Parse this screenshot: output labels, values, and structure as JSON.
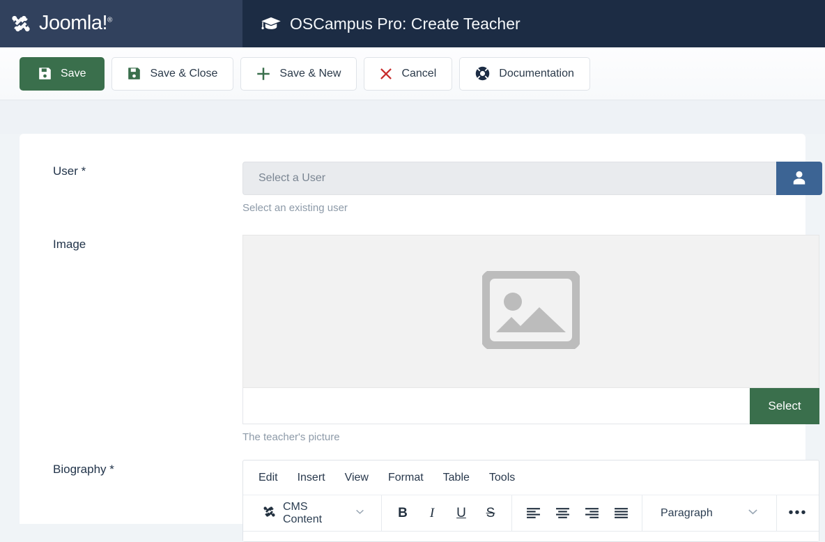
{
  "header": {
    "brand_name": "Joomla!",
    "brand_trademark": "®",
    "brand_logo_icon": "joomla-logo-icon",
    "page_icon": "graduation-cap-icon",
    "page_title": "OSCampus Pro: Create Teacher",
    "brand_bg": "#31415d",
    "title_bg": "#1c2c44"
  },
  "toolbar": {
    "buttons": [
      {
        "label": "Save",
        "icon": "floppy-disk-icon",
        "variant": "primary"
      },
      {
        "label": "Save & Close",
        "icon": "floppy-disk-icon",
        "variant": "default"
      },
      {
        "label": "Save & New",
        "icon": "plus-icon",
        "variant": "default"
      },
      {
        "label": "Cancel",
        "icon": "times-icon",
        "variant": "default"
      },
      {
        "label": "Documentation",
        "icon": "life-ring-icon",
        "variant": "default"
      }
    ],
    "primary_color": "#3a6f4c",
    "danger_color": "#c72d2d"
  },
  "form": {
    "user": {
      "label": "User *",
      "placeholder": "Select a User",
      "value": "",
      "picker_icon": "user-icon",
      "picker_color": "#3c6494",
      "help": "Select an existing user"
    },
    "image": {
      "label": "Image",
      "placeholder_icon": "image-placeholder-icon",
      "path_value": "",
      "select_label": "Select",
      "select_color": "#3a6f4c",
      "help": "The teacher's picture"
    },
    "biography": {
      "label": "Biography *",
      "editor": {
        "menubar": [
          "Edit",
          "Insert",
          "View",
          "Format",
          "Table",
          "Tools"
        ],
        "cms_content": {
          "label": "CMS Content",
          "icon": "joomla-logo-icon",
          "chevron": "chevron-down-icon"
        },
        "format_buttons": [
          {
            "name": "bold",
            "glyph": "B"
          },
          {
            "name": "italic",
            "glyph": "I"
          },
          {
            "name": "underline",
            "glyph": "U"
          },
          {
            "name": "strikethrough",
            "glyph": "S"
          }
        ],
        "align_buttons": [
          {
            "name": "align-left"
          },
          {
            "name": "align-center"
          },
          {
            "name": "align-right"
          },
          {
            "name": "align-justify"
          }
        ],
        "block_format": {
          "value": "Paragraph",
          "chevron": "chevron-down-icon"
        },
        "overflow": "•••"
      }
    }
  }
}
